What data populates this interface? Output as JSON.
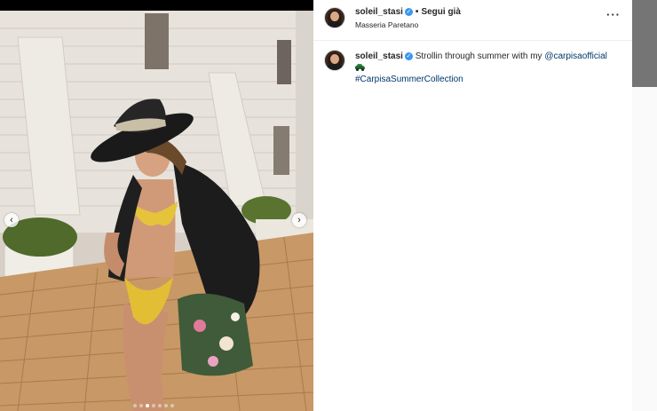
{
  "post": {
    "username": "soleil_stasi",
    "verified_icon": "verified-badge-icon",
    "separator": "•",
    "follow_label": "Segui già",
    "location": "Masseria Paretano",
    "more_icon_glyph": "···"
  },
  "caption": {
    "username": "soleil_stasi",
    "text_before": "Strollin through summer with my",
    "mention": "@carpisaofficial",
    "emoji": "race-car-emoji",
    "hashtag": "#CarpisaSummerCollection"
  },
  "carousel": {
    "prev_glyph": "‹",
    "next_glyph": "›",
    "slide_count": 7,
    "active_slide_index": 2
  },
  "colors": {
    "link": "#00376b",
    "verified": "#3897f0",
    "scrollbar": "#757575"
  }
}
